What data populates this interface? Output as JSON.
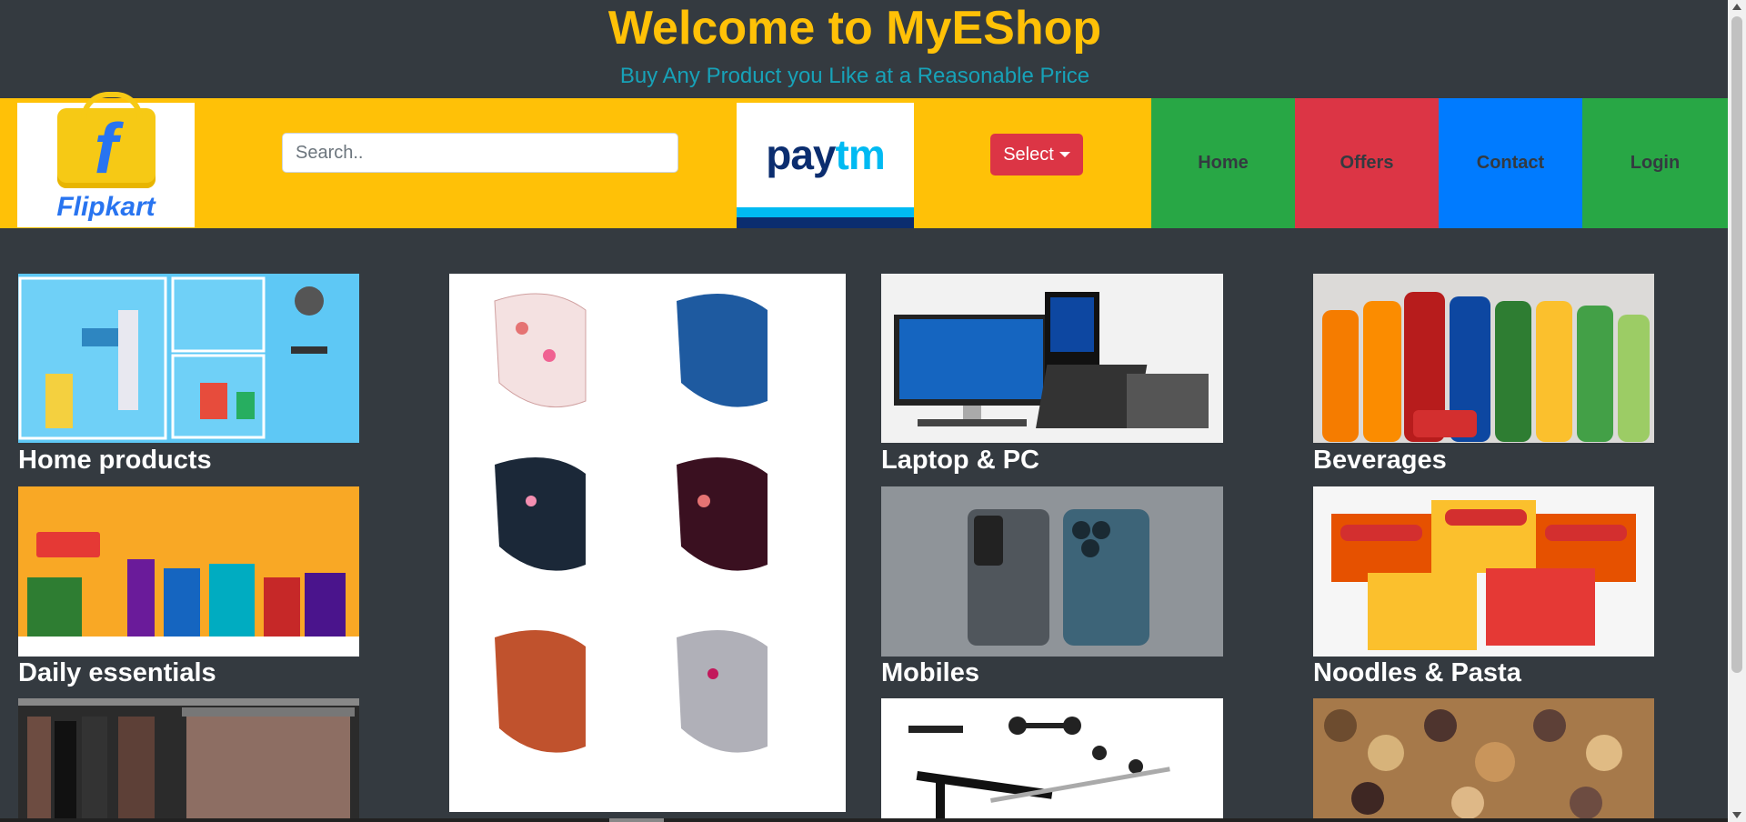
{
  "header": {
    "title": "Welcome to MyEShop",
    "subtitle": "Buy Any Product you Like at a Reasonable Price"
  },
  "navbar": {
    "flipkart_logo_text": "Flipkart",
    "search_placeholder": "Search..",
    "paytm_logo": {
      "pay": "pay",
      "tm": "tm"
    },
    "select_label": "Select",
    "items": [
      {
        "label": "Home",
        "color": "#28a745"
      },
      {
        "label": "Offers",
        "color": "#dc3545"
      },
      {
        "label": "Contact",
        "color": "#007bff"
      },
      {
        "label": "Login",
        "color": "#28a745"
      }
    ]
  },
  "categories": [
    {
      "label": "Home products"
    },
    {
      "label": "Daily essentials"
    },
    {
      "label": "Laptop & PC"
    },
    {
      "label": "Mobiles"
    },
    {
      "label": "Beverages"
    },
    {
      "label": "Noodles & Pasta"
    }
  ],
  "colors": {
    "background": "#343a40",
    "accent_yellow": "#ffc107",
    "accent_teal": "#17a2b8"
  }
}
